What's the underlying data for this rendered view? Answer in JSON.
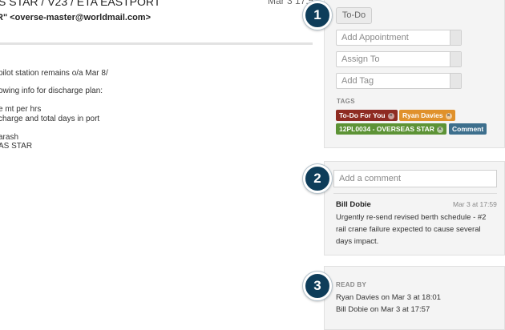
{
  "email": {
    "subject": "S STAR / V23 / ETA EASTPORT",
    "date": "Mar 3 17:57",
    "from": "R\" <overse-master@worldmail.com>",
    "body_lines": [
      "pilot station remains o/a Mar 8/",
      "owing info for discharge plan:",
      "e mt per hrs",
      "charge and total days in port",
      "arash",
      "AS STAR"
    ]
  },
  "sidebar": {
    "step1": {
      "badge": "1",
      "todo_button": "To-Do",
      "add_appointment": "Add Appointment",
      "assign_to": "Assign To",
      "add_tag": "Add Tag",
      "tags_label": "TAGS",
      "tags": [
        {
          "label": "To-Do For You",
          "color": "#8e2b22"
        },
        {
          "label": "Ryan Davies",
          "color": "#e0912b"
        },
        {
          "label": "12PL0034 - OVERSEAS STAR",
          "color": "#5d9336"
        },
        {
          "label": "Comment",
          "color": "#3d6f8d"
        }
      ]
    },
    "step2": {
      "badge": "2",
      "comment_placeholder": "Add a comment",
      "comment": {
        "author": "Bill Dobie",
        "time": "Mar 3 at 17:59",
        "text": "Urgently re-send revised berth schedule - #2 rail crane failure expected to cause several days impact."
      }
    },
    "step3": {
      "badge": "3",
      "read_by_label": "READ BY",
      "read_by": [
        "Ryan Davies on Mar 3 at 18:01",
        "Bill Dobie on Mar 3 at 17:57"
      ]
    }
  },
  "colors": {
    "badge": "#0e3d5a",
    "panel": "#f4f4f4"
  }
}
